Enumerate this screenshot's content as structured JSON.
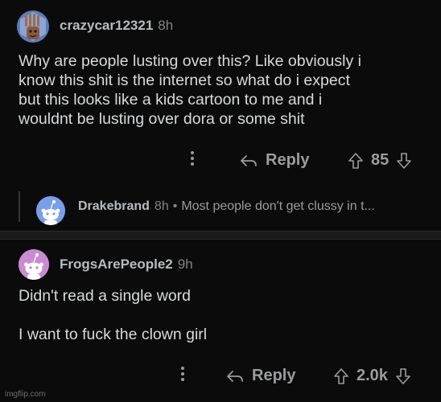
{
  "comments": [
    {
      "username": "crazycar12321",
      "time": "8h",
      "body_lines": [
        "Why are people lusting over this? Like obviously i",
        "know this shit is the internet so what do i expect",
        "but this looks like a kids cartoon to me and i",
        "wouldnt be lusting over dora or some shit"
      ],
      "reply_label": "Reply",
      "vote_count": "85"
    },
    {
      "username": "FrogsArePeople2",
      "time": "9h",
      "body_lines": [
        "Didn't read a single word",
        "",
        "I want to fuck the clown girl"
      ],
      "reply_label": "Reply",
      "vote_count": "2.0k"
    }
  ],
  "collapsed_reply": {
    "username": "Drakebrand",
    "time": "8h",
    "separator": "•",
    "preview": "Most people don't get clussy in t..."
  },
  "icons": {
    "more": "vertical-ellipsis-icon",
    "reply": "reply-arrow-icon",
    "upvote": "upvote-arrow-icon",
    "downvote": "downvote-arrow-icon"
  },
  "colors": {
    "background": "#0b0b0b",
    "text": "#d7dadc",
    "muted": "#818384",
    "snoo_blue": "#7a9ee8",
    "snoo_pink": "#c98bd1"
  },
  "watermark": "imgflip.com"
}
